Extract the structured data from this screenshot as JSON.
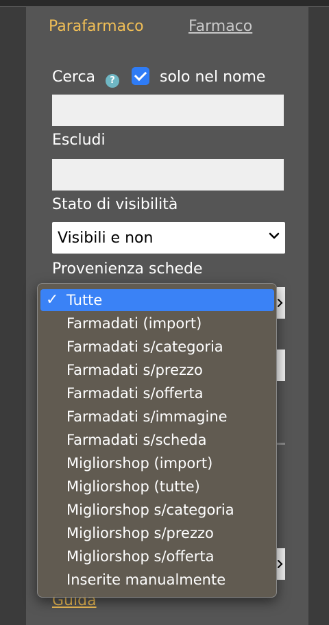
{
  "tabs": {
    "active": "Parafarmaco",
    "other": "Farmaco"
  },
  "search": {
    "label": "Cerca",
    "help_icon": "?",
    "name_only_label": "solo nel nome",
    "name_only_checked": true,
    "value": ""
  },
  "exclude": {
    "label": "Escludi",
    "value": ""
  },
  "visibility": {
    "label": "Stato di visibilità",
    "selected": "Visibili e non"
  },
  "provenance": {
    "label": "Provenienza schede",
    "selected": "Tutte",
    "options": [
      "Tutte",
      "Farmadati (import)",
      "Farmadati s/categoria",
      "Farmadati s/prezzo",
      "Farmadati s/offerta",
      "Farmadati s/immagine",
      "Farmadati s/scheda",
      "Migliorshop (import)",
      "Migliorshop (tutte)",
      "Migliorshop s/categoria",
      "Migliorshop s/prezzo",
      "Migliorshop s/offerta",
      "Inserite manualmente"
    ]
  },
  "footer": {
    "guide_link": "Guida"
  },
  "colors": {
    "accent": "#f0be56",
    "selection": "#3a82f6",
    "panel": "#555555"
  }
}
